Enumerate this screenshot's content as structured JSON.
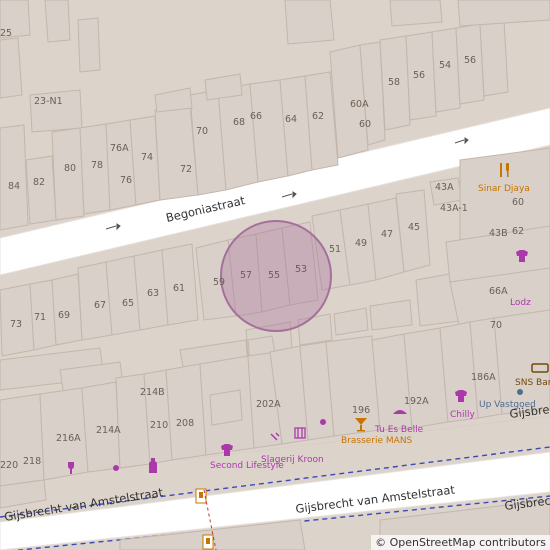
{
  "map": {
    "streets": {
      "begonia": "Begoniastraat",
      "gijsbrecht": "Gijsbrecht van Amstelstraat"
    },
    "house_numbers": [
      "25",
      "23-N1",
      "84",
      "82",
      "80",
      "78",
      "76A",
      "76",
      "74",
      "72",
      "70",
      "68",
      "66",
      "64",
      "62",
      "60A",
      "60",
      "58",
      "56",
      "54",
      "56",
      "43A",
      "43A-1",
      "43B",
      "60",
      "62",
      "51",
      "49",
      "47",
      "45",
      "59",
      "57",
      "55",
      "53",
      "73",
      "71",
      "69",
      "67",
      "65",
      "63",
      "61",
      "66A",
      "70",
      "186A",
      "214B",
      "202A",
      "214A",
      "210",
      "208",
      "216A",
      "196",
      "192A",
      "220",
      "218"
    ],
    "pois": [
      {
        "name": "Sinar Djaya",
        "icon": "restaurant-icon",
        "color": "#c77400"
      },
      {
        "name": "Lodz",
        "icon": "clothes-icon",
        "color": "#ac39ac"
      },
      {
        "name": "SNS Bank",
        "icon": "bank-icon",
        "color": "#734a08"
      },
      {
        "name": "Up Vastgoed",
        "icon": "office-icon",
        "color": "#4f6d8f"
      },
      {
        "name": "Chilly",
        "icon": "clothes-icon",
        "color": "#ac39ac"
      },
      {
        "name": "Tu Es Belle",
        "icon": "beauty-icon",
        "color": "#ac39ac"
      },
      {
        "name": "Brasserie MANS",
        "icon": "bar-icon",
        "color": "#c77400"
      },
      {
        "name": "Slagerij Kroon",
        "icon": "butcher-icon",
        "color": "#ac39ac"
      },
      {
        "name": "Second Lifestyle",
        "icon": "clothes-icon",
        "color": "#ac39ac"
      },
      {
        "name": "liquor-shop",
        "icon": "liquor-icon",
        "color": "#ac39ac"
      },
      {
        "name": "wine-shop",
        "icon": "wine-icon",
        "color": "#ac39ac"
      }
    ],
    "highlight_color": "#a5719b",
    "attribution": "© OpenStreetMap contributors"
  }
}
